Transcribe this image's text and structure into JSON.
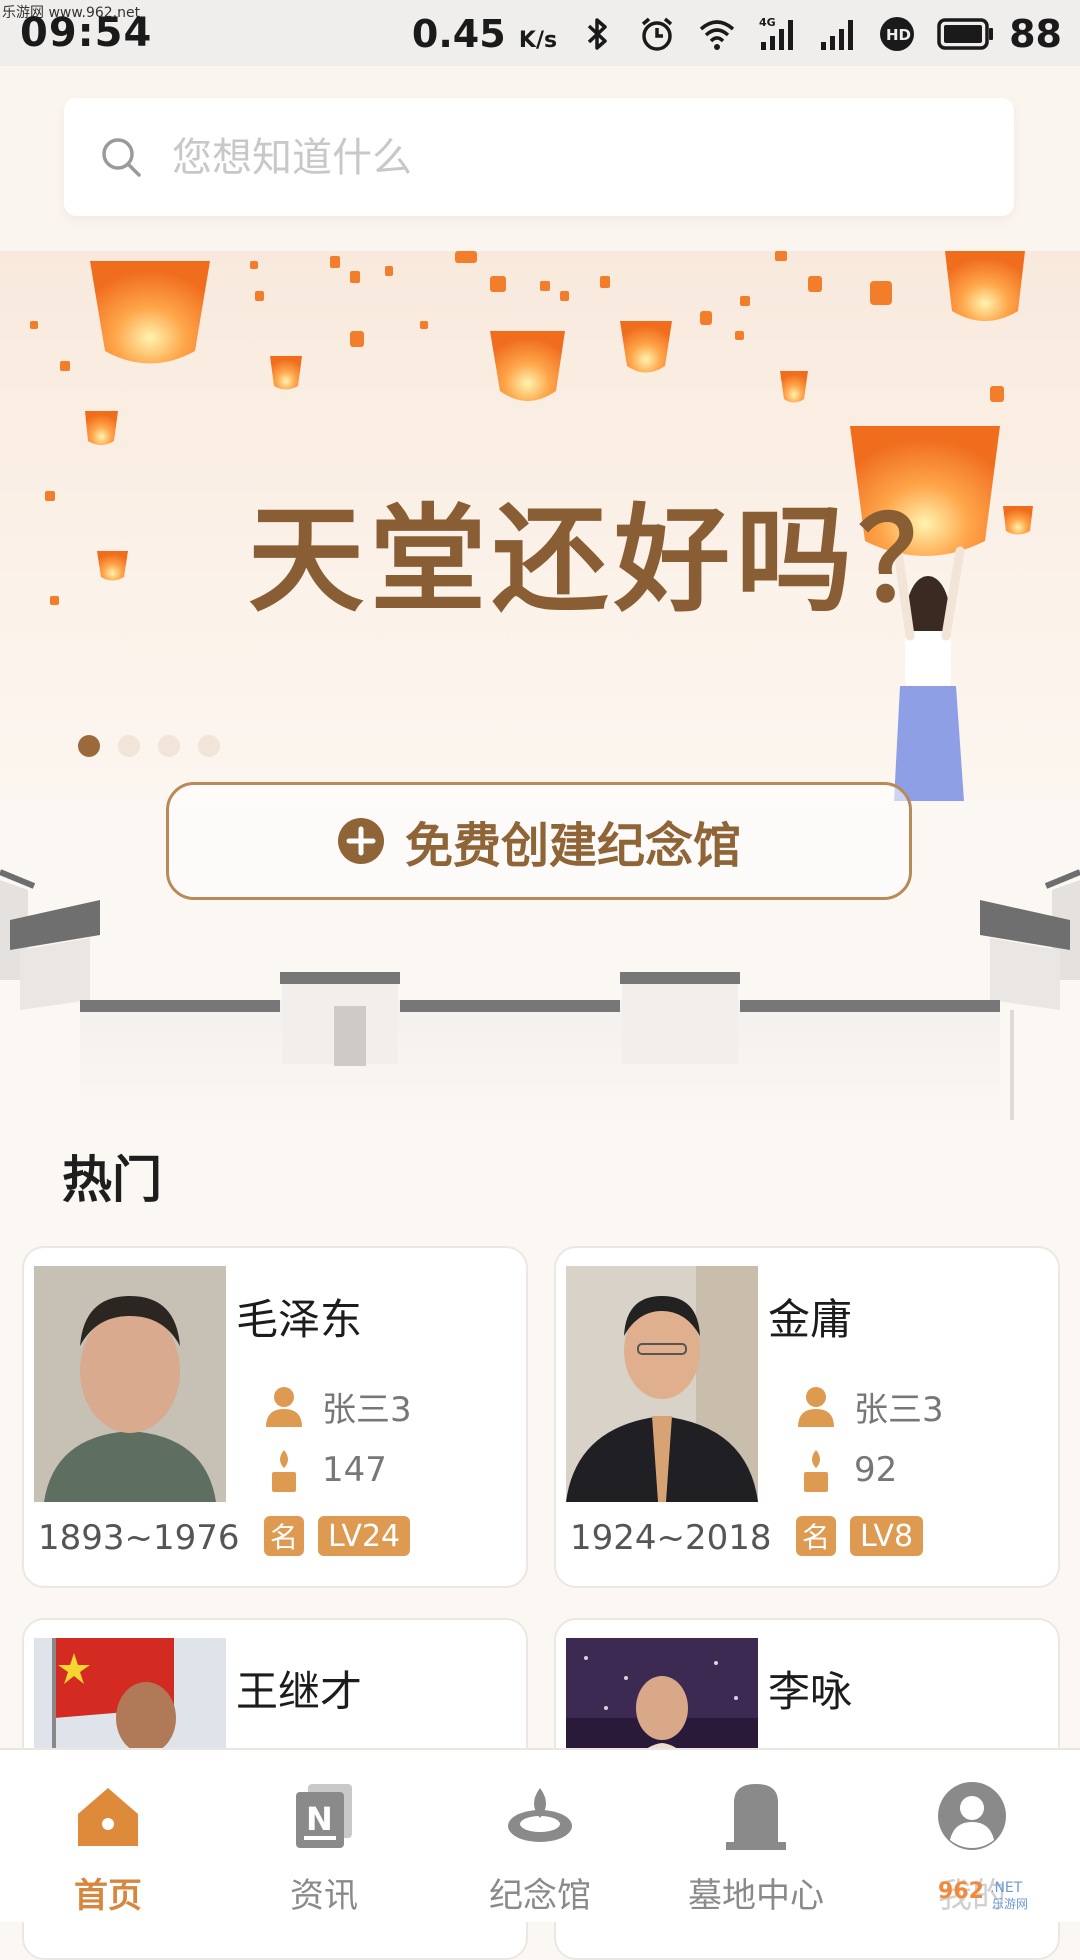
{
  "status_bar": {
    "watermark": "乐游网 www.962.net",
    "time": "09:54",
    "speed": "0.45",
    "speed_unit": "K/s",
    "battery": "88",
    "network": "4G",
    "icons": [
      "bluetooth-icon",
      "alarm-icon",
      "wifi-icon",
      "signal-4g-icon",
      "signal-icon",
      "hd-icon",
      "battery-icon"
    ]
  },
  "search": {
    "placeholder": "您想知道什么",
    "value": ""
  },
  "banner": {
    "title": "天堂还好吗？",
    "dot_count": 4,
    "active_dot": 0
  },
  "create_button": {
    "label": "免费创建纪念馆"
  },
  "hot": {
    "title": "热门",
    "cards": [
      {
        "name": "毛泽东",
        "creator": "张三3",
        "candles": "147",
        "years": "1893~1976",
        "badge": "名",
        "level": "LV24"
      },
      {
        "name": "金庸",
        "creator": "张三3",
        "candles": "92",
        "years": "1924~2018",
        "badge": "名",
        "level": "LV8"
      },
      {
        "name": "王继才"
      },
      {
        "name": "李咏"
      }
    ]
  },
  "nav": {
    "items": [
      {
        "label": "首页",
        "icon": "home-icon",
        "active": true
      },
      {
        "label": "资讯",
        "icon": "news-icon",
        "active": false
      },
      {
        "label": "纪念馆",
        "icon": "memorial-icon",
        "active": false
      },
      {
        "label": "墓地中心",
        "icon": "tombstone-icon",
        "active": false
      },
      {
        "label": "我的",
        "icon": "profile-icon",
        "active": false
      }
    ]
  },
  "watermark_bottom": "962.NET 乐游网",
  "colors": {
    "accent": "#d7873d",
    "brown": "#8f6436",
    "badge": "#dd9a50"
  }
}
